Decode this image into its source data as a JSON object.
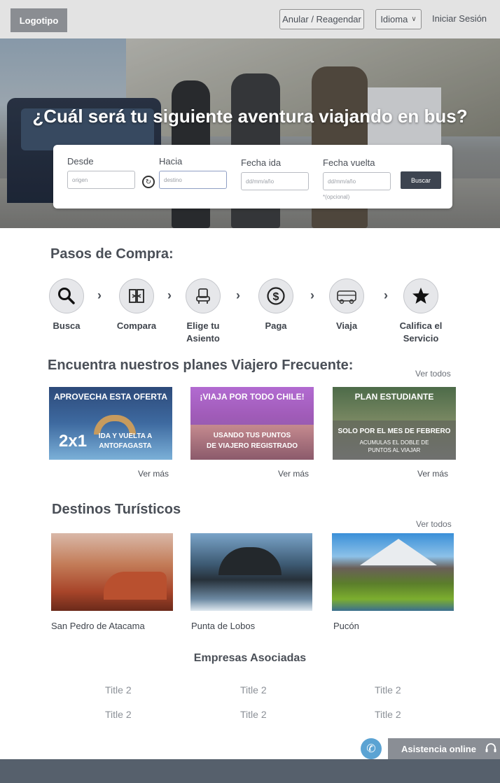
{
  "header": {
    "logo": "Logotipo",
    "anular_label": "Anular / Reagendar",
    "idioma_label": "Idioma",
    "login_label": "Iniciar Sesión"
  },
  "hero": {
    "title": "¿Cuál será tu siguiente aventura viajando en bus?"
  },
  "search": {
    "desde_label": "Desde",
    "desde_placeholder": "origen",
    "hacia_label": "Hacia",
    "hacia_placeholder": "destino",
    "fecha_ida_label": "Fecha ida",
    "fecha_ida_placeholder": "dd/mm/año",
    "fecha_vuelta_label": "Fecha vuelta",
    "fecha_vuelta_placeholder": "dd/mm/año",
    "opcional": "*(opcional)",
    "buscar_label": "Buscar"
  },
  "steps": {
    "title": "Pasos de Compra:",
    "items": [
      {
        "label": "Busca",
        "icon": "search-icon"
      },
      {
        "label": "Compara",
        "icon": "compare-icon"
      },
      {
        "label": "Elige tu Asiento",
        "icon": "seat-icon"
      },
      {
        "label": "Paga",
        "icon": "dollar-icon"
      },
      {
        "label": "Viaja",
        "icon": "bus-icon"
      },
      {
        "label": "Califica el Servicio",
        "icon": "star-icon"
      }
    ]
  },
  "plans": {
    "title": "Encuentra nuestros planes Viajero Frecuente:",
    "ver_todos": "Ver todos",
    "ver_mas": "Ver más",
    "cards": [
      {
        "headline": "APROVECHA ESTA OFERTA",
        "big": "2x1",
        "line1": "IDA Y VUELTA A",
        "line2": "ANTOFAGASTA"
      },
      {
        "headline": "¡VIAJA POR TODO CHILE!",
        "line1": "USANDO TUS PUNTOS",
        "line2": "DE VIAJERO REGISTRADO"
      },
      {
        "headline": "PLAN ESTUDIANTE",
        "line1": "SOLO POR EL MES DE FEBRERO",
        "line2": "ACUMULAS EL DOBLE DE",
        "line3": "PUNTOS AL VIAJAR"
      }
    ]
  },
  "destinations": {
    "title": "Destinos Turísticos",
    "ver_todos": "Ver todos",
    "items": [
      {
        "name": "San Pedro de Atacama"
      },
      {
        "name": "Punta de Lobos"
      },
      {
        "name": "Pucón"
      }
    ]
  },
  "partners": {
    "title": "Empresas Asociadas",
    "items": [
      "Title 2",
      "Title 2",
      "Title 2",
      "Title 2",
      "Title 2",
      "Title 2"
    ]
  },
  "assistance": {
    "label": "Asistencia online"
  }
}
